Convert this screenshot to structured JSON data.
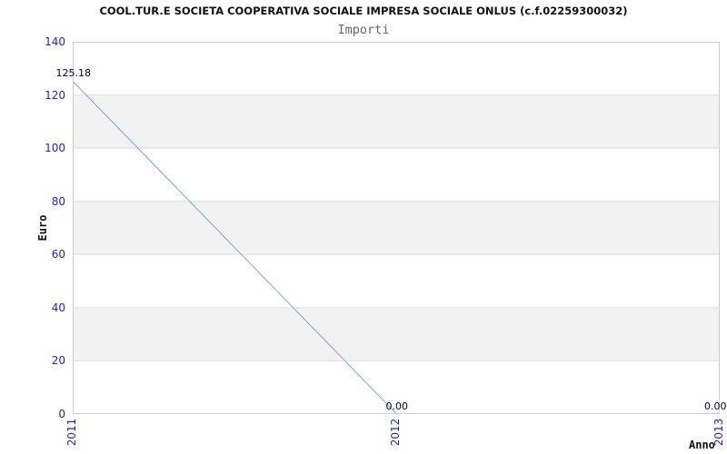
{
  "chart_data": {
    "type": "line",
    "title": "COOL.TUR.E SOCIETA COOPERATIVA SOCIALE IMPRESA SOCIALE ONLUS (c.f.02259300032)",
    "subtitle": "Importi",
    "xlabel": "Anno",
    "ylabel": "Euro",
    "categories": [
      "2011",
      "2012",
      "2013"
    ],
    "series": [
      {
        "name": "Importi",
        "values": [
          125.18,
          0,
          0
        ],
        "point_labels": [
          "125.18",
          "0.00",
          "0.00"
        ]
      }
    ],
    "ylim": [
      0,
      140
    ],
    "yticks": [
      0,
      20,
      40,
      60,
      80,
      100,
      120,
      140
    ],
    "grid": "horizontal-bands-alternating",
    "legend_position": "none",
    "colors": {
      "tick_label": "#2222cc",
      "point_label": "#000033",
      "line": "#7aa7d9",
      "band": "#f2f2f2",
      "grid_line": "#dddddd",
      "plot_border": "#cccccc",
      "title": "#111111",
      "subtitle": "#666666",
      "background": "#ffffff"
    }
  }
}
